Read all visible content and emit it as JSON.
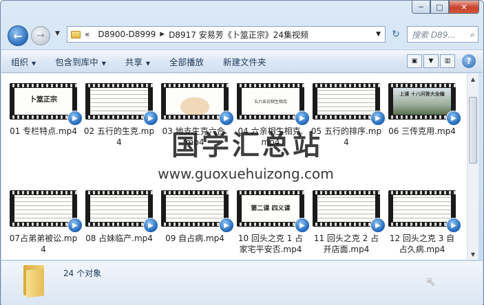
{
  "window": {
    "caption_buttons": {
      "minimize": "─",
      "maximize": "□",
      "close": "✕"
    }
  },
  "address": {
    "overflow": "«",
    "crumbs": [
      "D8900-D8999",
      "D8917 安易芳《卜筮正宗》24集视频"
    ],
    "search_placeholder": "搜索 D89..."
  },
  "toolbar": {
    "organize": "组织",
    "include_library": "包含到库中",
    "share": "共享",
    "play_all": "全部播放",
    "new_folder": "新建文件夹",
    "help": "?"
  },
  "thumbnails": {
    "t1_title": "卜筮正宗",
    "t4_title": "五六亲论相生相克",
    "t6_title": "上课  十八问答大全编",
    "t10_title": "第二课  四义课"
  },
  "files": [
    {
      "name": "01 专栏特点.mp4"
    },
    {
      "name": "02 五行的生克.mp4"
    },
    {
      "name": "03 地支生克六合.mp4"
    },
    {
      "name": "04 六亲相生相克.mp4"
    },
    {
      "name": "05 五行的排序.mp4"
    },
    {
      "name": "06 三传克用.mp4"
    },
    {
      "name": "07占弟弟被讼.mp4"
    },
    {
      "name": "08 占妹临产.mp4"
    },
    {
      "name": "09 自占病.mp4"
    },
    {
      "name": "10 回头之克 1 占家宅平安否.mp4"
    },
    {
      "name": "11 回头之克 2 占开店面.mp4"
    },
    {
      "name": "12 回头之克 3 自占久病.mp4"
    }
  ],
  "status": {
    "count": "24 个对象"
  },
  "watermark": {
    "title": "国学汇总站",
    "url": "www.guoxuehuizong.com"
  },
  "icons": {
    "back": "back-arrow-icon",
    "forward": "forward-arrow-icon",
    "refresh": "refresh-icon",
    "search": "search-icon",
    "folder": "folder-icon",
    "video": "video-file-icon",
    "media_badge": "media-player-badge-icon"
  },
  "colors": {
    "accent": "#2d6fbd",
    "close_button": "#c7412b",
    "toolbar_text": "#1e395b"
  }
}
